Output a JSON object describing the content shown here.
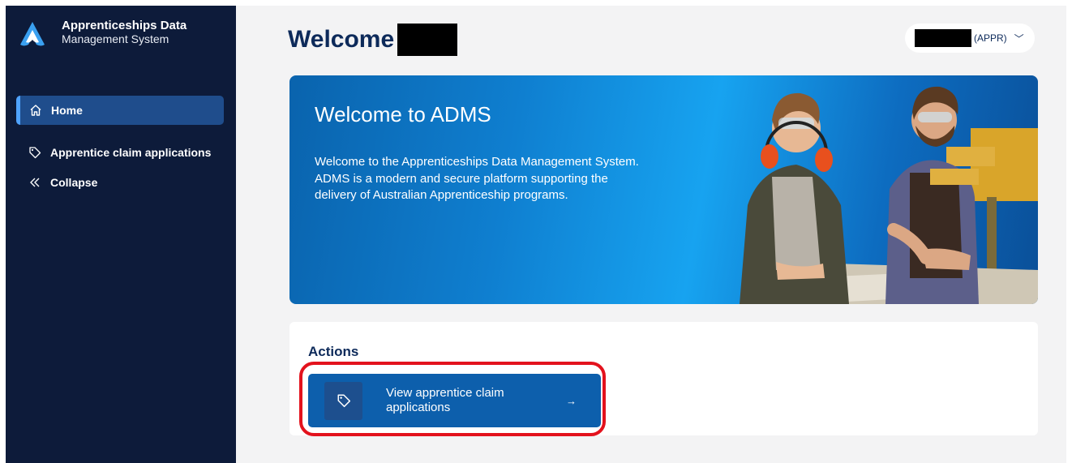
{
  "brand": {
    "title": "Apprenticeships Data",
    "subtitle": "Management System"
  },
  "sidebar": {
    "items": [
      {
        "label": "Home",
        "icon": "home-icon",
        "active": true
      },
      {
        "label": "Apprentice claim applications",
        "icon": "tag-icon",
        "active": false
      },
      {
        "label": "Collapse",
        "icon": "double-chevron-left-icon",
        "active": false
      }
    ]
  },
  "header": {
    "welcome": "Welcome",
    "user_role": "(APPR)",
    "chevron": "﹀"
  },
  "hero": {
    "title": "Welcome to ADMS",
    "text": "Welcome to the Apprenticeships Data Management System. ADMS is a modern and secure platform supporting the delivery of Australian Apprenticeship programs."
  },
  "actions": {
    "title": "Actions",
    "buttons": [
      {
        "label": "View apprentice claim applications",
        "icon": "tag-icon",
        "arrow": "→"
      }
    ]
  },
  "colors": {
    "sidebar_bg": "#0d1b3a",
    "active_item": "#1f4d8c",
    "brand_accent": "#2e8ce6",
    "action_button": "#0d5fac",
    "highlight": "#e3121d",
    "heading": "#0d2a5a"
  }
}
